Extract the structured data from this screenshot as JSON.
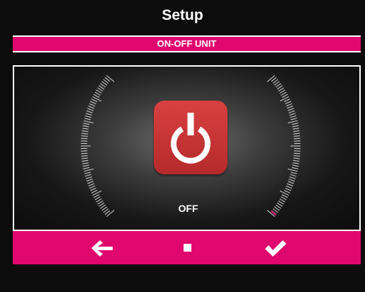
{
  "header": {
    "title": "Setup"
  },
  "section": {
    "label": "ON-OFF UNIT"
  },
  "panel": {
    "power_button": {
      "icon": "power-icon",
      "color": "#c93635"
    },
    "status_text": "OFF"
  },
  "navbar": {
    "back": {
      "icon": "arrow-left-icon"
    },
    "home": {
      "icon": "square-icon"
    },
    "confirm": {
      "icon": "checkmark-icon"
    }
  },
  "colors": {
    "accent": "#e0086e",
    "background": "#0c0c0c",
    "power_red": "#c93635"
  }
}
